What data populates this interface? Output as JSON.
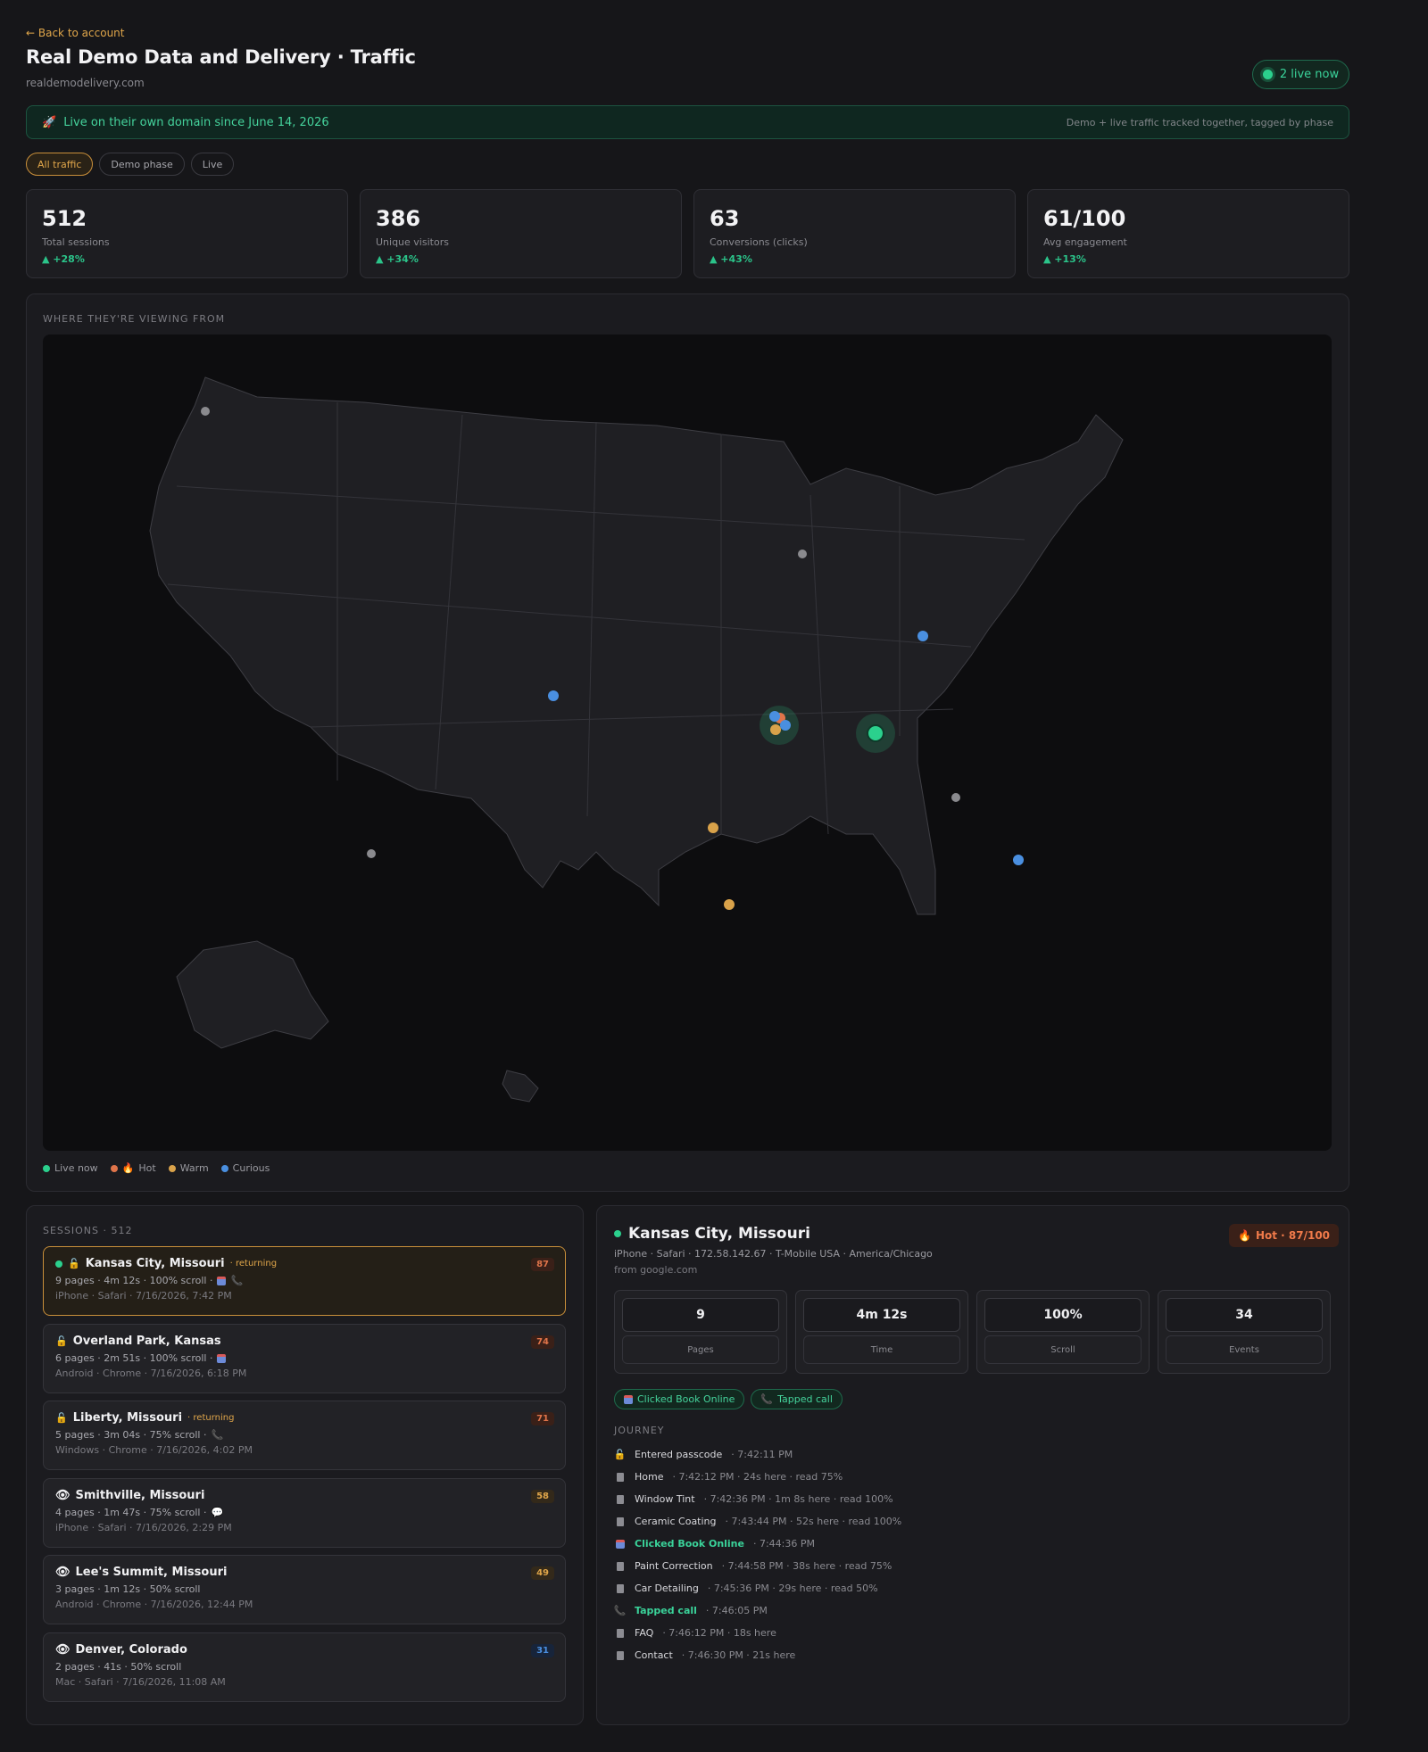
{
  "header": {
    "back": "← Back to account",
    "title": "Real Demo Data and Delivery · Traffic",
    "domain": "realdemodelivery.com",
    "live_count": "2 live now"
  },
  "banner": {
    "text": "Live on their own domain since June 14, 2026",
    "note": "Demo + live traffic tracked together, tagged by phase"
  },
  "filters": [
    "All traffic",
    "Demo phase",
    "Live"
  ],
  "stats": [
    {
      "value": "512",
      "label": "Total sessions",
      "delta": "+28%"
    },
    {
      "value": "386",
      "label": "Unique visitors",
      "delta": "+34%"
    },
    {
      "value": "63",
      "label": "Conversions (clicks)",
      "delta": "+43%"
    },
    {
      "value": "61/100",
      "label": "Avg engagement",
      "delta": "+13%"
    }
  ],
  "map": {
    "label": "WHERE THEY'RE VIEWING FROM",
    "legend": [
      "Live now",
      "Hot",
      "Warm",
      "Curious"
    ],
    "colors": {
      "live": "#2bd08d",
      "hot": "#e0744a",
      "warm": "#d9a24a",
      "curious": "#4a8fe0",
      "inactive": "#8a8a8e"
    }
  },
  "sessions": {
    "label": "SESSIONS · 512",
    "items": [
      {
        "city": "Kansas City, Missouri",
        "tag": "· returning",
        "stats": "9 pages · 4m 12s · 100% scroll ·",
        "device": "iPhone · Safari · 7/16/2026, 7:42 PM",
        "score": "87"
      },
      {
        "city": "Overland Park, Kansas",
        "tag": "",
        "stats": "6 pages · 2m 51s · 100% scroll ·",
        "device": "Android · Chrome · 7/16/2026, 6:18 PM",
        "score": "74"
      },
      {
        "city": "Liberty, Missouri",
        "tag": "· returning",
        "stats": "5 pages · 3m 04s · 75% scroll ·",
        "device": "Windows · Chrome · 7/16/2026, 4:02 PM",
        "score": "71"
      },
      {
        "city": "Smithville, Missouri",
        "tag": "",
        "stats": "4 pages · 1m 47s · 75% scroll ·",
        "device": "iPhone · Safari · 7/16/2026, 2:29 PM",
        "score": "58"
      },
      {
        "city": "Lee's Summit, Missouri",
        "tag": "",
        "stats": "3 pages · 1m 12s · 50% scroll",
        "device": "Android · Chrome · 7/16/2026, 12:44 PM",
        "score": "49"
      },
      {
        "city": "Denver, Colorado",
        "tag": "",
        "stats": "2 pages · 41s · 50% scroll",
        "device": "Mac · Safari · 7/16/2026, 11:08 AM",
        "score": "31"
      }
    ]
  },
  "detail": {
    "city": "Kansas City, Missouri",
    "meta": "iPhone · Safari · 172.58.142.67 · T-Mobile USA · America/Chicago",
    "ref": "from google.com",
    "badge": "Hot · 87/100",
    "metrics": [
      {
        "value": "9",
        "label": "Pages"
      },
      {
        "value": "4m 12s",
        "label": "Time"
      },
      {
        "value": "100%",
        "label": "Scroll"
      },
      {
        "value": "34",
        "label": "Events"
      }
    ],
    "chips": [
      "Clicked Book Online",
      "Tapped call"
    ],
    "journey_label": "JOURNEY",
    "journey": [
      {
        "name": "Entered passcode",
        "info": "· 7:42:11 PM"
      },
      {
        "name": "Home",
        "info": "· 7:42:12 PM · 24s here · read 75%"
      },
      {
        "name": "Window Tint",
        "info": "· 7:42:36 PM · 1m 8s here · read 100%"
      },
      {
        "name": "Ceramic Coating",
        "info": "· 7:43:44 PM · 52s here · read 100%"
      },
      {
        "name": "Clicked Book Online",
        "info": "· 7:44:36 PM"
      },
      {
        "name": "Paint Correction",
        "info": "· 7:44:58 PM · 38s here · read 75%"
      },
      {
        "name": "Car Detailing",
        "info": "· 7:45:36 PM · 29s here · read 50%"
      },
      {
        "name": "Tapped call",
        "info": "· 7:46:05 PM"
      },
      {
        "name": "FAQ",
        "info": "· 7:46:12 PM · 18s here"
      },
      {
        "name": "Contact",
        "info": "· 7:46:30 PM · 21s here"
      }
    ]
  }
}
